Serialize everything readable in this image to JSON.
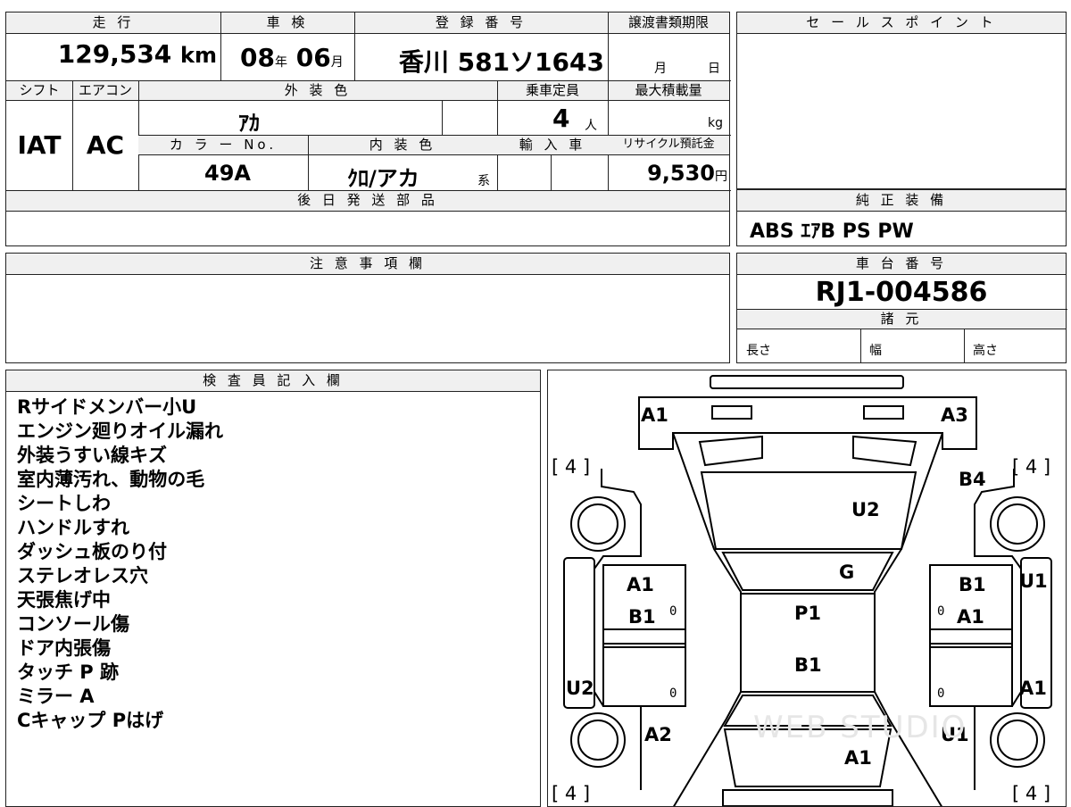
{
  "top_row": {
    "mileage_label": "走 行",
    "mileage_value": "129,534",
    "mileage_unit": "km",
    "inspection_label": "車 検",
    "inspection_year": "08",
    "inspection_year_unit": "年",
    "inspection_month": "06",
    "inspection_month_unit": "月",
    "registration_label": "登 録 番 号",
    "registration_value": "香川 581ソ1643",
    "transfer_docs_label": "譲渡書類期限",
    "transfer_month_unit": "月",
    "transfer_day_unit": "日"
  },
  "second_row": {
    "shift_label": "シフト",
    "shift_value": "IAT",
    "ac_label": "エアコン",
    "ac_value": "AC",
    "exterior_color_label": "外 装 色",
    "exterior_color_value": "ｱｶ",
    "capacity_label": "乗車定員",
    "capacity_value": "4",
    "capacity_unit": "人",
    "max_load_label": "最大積載量",
    "max_load_unit": "kg",
    "color_no_label": "カ ラ ー No.",
    "color_no_value": "49A",
    "interior_color_label": "内 装 色",
    "interior_color_value": "ｸﾛ/アカ",
    "interior_suffix": "系",
    "import_label": "輸 入 車",
    "recycle_label": "リサイクル預託金",
    "recycle_value": "9,530",
    "recycle_unit": "円"
  },
  "later_parts": {
    "label": "後 日 発 送 部 品",
    "value": ""
  },
  "caution": {
    "label": "注 意 事 項 欄",
    "value": ""
  },
  "sale_points": {
    "label": "セ ー ル ス ポ イ ン ト",
    "value": ""
  },
  "genuine_equipment": {
    "label": "純 正 装 備",
    "value": "ABS ｴｱB PS PW"
  },
  "chassis": {
    "label": "車 台 番 号",
    "value": "RJ1-004586"
  },
  "specs": {
    "label": "諸 元",
    "length_label": "長さ",
    "width_label": "幅",
    "height_label": "高さ"
  },
  "inspector": {
    "label": "検 査 員 記 入 欄",
    "notes": [
      "Rサイドメンバー小U",
      "エンジン廻りオイル漏れ",
      "外装うすい線キズ",
      "室内薄汚れ、動物の毛",
      "シートしわ",
      "ハンドルすれ",
      "ダッシュ板のり付",
      "ステレオレス穴",
      "天張焦げ中",
      "コンソール傷",
      "ドア内張傷",
      "タッチ P 跡",
      "ミラー A",
      "Cキャップ Pはげ"
    ]
  },
  "diagram": {
    "marks": {
      "front_left": "A1",
      "front_right": "A3",
      "bonnet": "U2",
      "right_front_fender": "B4",
      "windshield": "G",
      "front_left_door_a": "A1",
      "front_left_door_b": "B1",
      "front_right_door_a": "B1",
      "front_right_door_b": "A1",
      "roof_front": "P1",
      "roof_rear": "B1",
      "right_step_front": "U1",
      "left_step_rear": "U2",
      "right_step_rear": "A1",
      "left_rear_fender": "A2",
      "right_rear_fender": "U1",
      "rear": "A1"
    },
    "tire_tl": "[ 4 ]",
    "tire_tr": "[ 4 ]",
    "tire_bl": "[ 4 ]",
    "tire_br": "[ 4 ]",
    "zero": "0",
    "watermark": "WEB STUDIO"
  }
}
